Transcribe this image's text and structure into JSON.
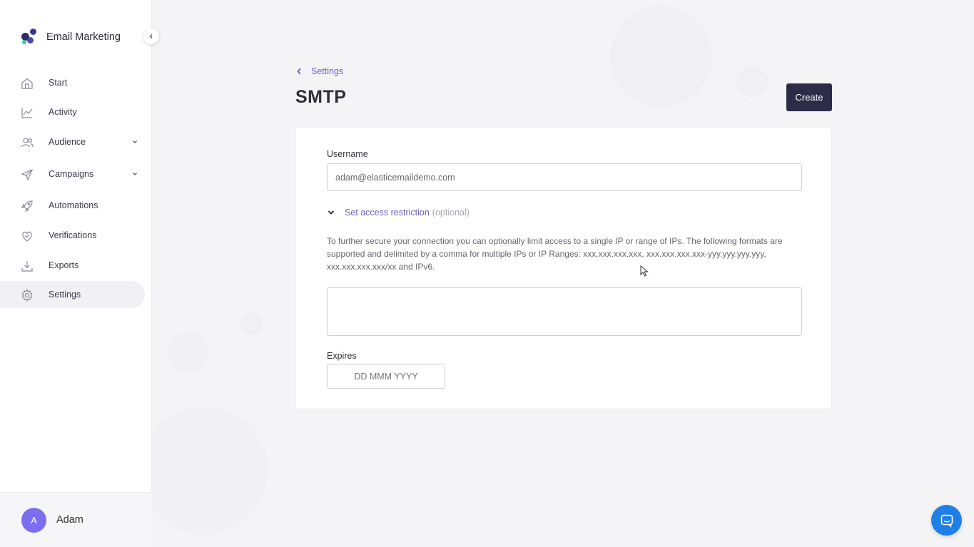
{
  "app": {
    "name": "Email Marketing"
  },
  "sidebar": {
    "items": [
      {
        "label": "Start",
        "icon": "home-icon"
      },
      {
        "label": "Activity",
        "icon": "chart-line-icon"
      },
      {
        "label": "Audience",
        "icon": "users-icon",
        "expandable": true
      },
      {
        "label": "Campaigns",
        "icon": "paper-plane-icon",
        "expandable": true
      },
      {
        "label": "Automations",
        "icon": "rocket-icon"
      },
      {
        "label": "Verifications",
        "icon": "heart-check-icon"
      },
      {
        "label": "Exports",
        "icon": "download-icon"
      },
      {
        "label": "Settings",
        "icon": "gear-icon",
        "active": true
      }
    ]
  },
  "user": {
    "initial": "A",
    "name": "Adam"
  },
  "breadcrumb": {
    "label": "Settings"
  },
  "page": {
    "title": "SMTP",
    "create_label": "Create"
  },
  "form": {
    "username_label": "Username",
    "username_value": "adam@elasticemaildemo.com",
    "restriction_label": "Set access restriction",
    "restriction_optional": "(optional)",
    "help_text": "To further secure your connection you can optionally limit access to a single IP or range of IPs. The following formats are supported and delimited by a comma for multiple IPs or IP Ranges: xxx.xxx.xxx.xxx, xxx.xxx.xxx.xxx-yyy.yyy.yyy.yyy, xxx.xxx.xxx.xxx/xx and IPv6.",
    "ip_value": "",
    "expires_label": "Expires",
    "expires_placeholder": "DD MMM YYYY"
  },
  "colors": {
    "accent": "#6a63c4",
    "create_bg": "#2c2c48",
    "avatar_bg": "#7b6ef0",
    "chat_bg": "#1f7fe6"
  }
}
